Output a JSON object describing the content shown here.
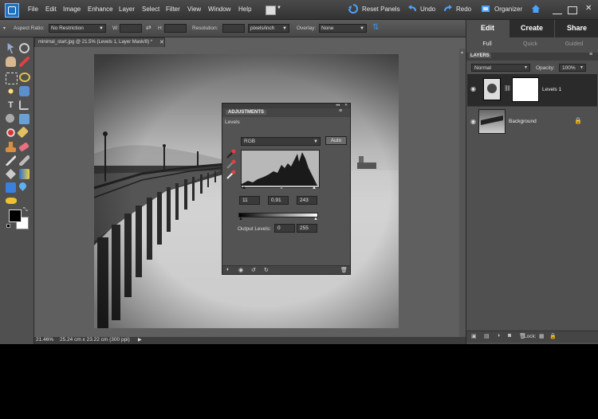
{
  "menubar": {
    "items": [
      "File",
      "Edit",
      "Image",
      "Enhance",
      "Layer",
      "Select",
      "Filter",
      "View",
      "Window",
      "Help"
    ],
    "reset_panels": "Reset Panels",
    "undo": "Undo",
    "redo": "Redo",
    "organizer": "Organizer"
  },
  "options": {
    "aspect_label": "Aspect Ratio:",
    "aspect_value": "No Restriction",
    "w_label": "W:",
    "h_label": "H:",
    "resolution_label": "Resolution:",
    "resolution_unit": "pixels/inch",
    "overlay_label": "Overlay:",
    "overlay_value": "None"
  },
  "document": {
    "tab_title": "minimal_start.jpg @ 21.5% (Levels 1, Layer Mask/8) *",
    "zoom": "21.46%",
    "info": "25.24 cm x 23.22 cm (300 ppi)"
  },
  "panel": {
    "mode_tabs": [
      "Edit",
      "Create",
      "Share"
    ],
    "sub_tabs": [
      "Full",
      "Quick",
      "Guided"
    ],
    "layers_title": "LAYERS",
    "blend_mode": "Normal",
    "opacity_label": "Opacity:",
    "opacity_value": "100%",
    "layers": [
      {
        "name": "Levels 1"
      },
      {
        "name": "Background"
      }
    ],
    "lock_label": "Lock:"
  },
  "adjustments": {
    "title": "ADJUSTMENTS",
    "subtitle": "Levels",
    "channel": "RGB",
    "auto": "Auto",
    "input_black": "11",
    "input_gamma": "0.91",
    "input_white": "243",
    "output_label": "Output Levels:",
    "output_black": "0",
    "output_white": "255"
  },
  "colors": {
    "accent": "#1e6fbf",
    "selected_layer": "#2a2a2a"
  }
}
